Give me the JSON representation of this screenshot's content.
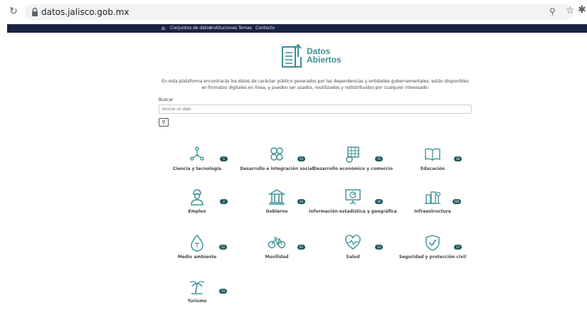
{
  "browser": {
    "url": "datos.jalisco.gob.mx"
  },
  "nav": {
    "items": [
      {
        "label": "Conjuntos de datos"
      },
      {
        "label": "Instituciones"
      },
      {
        "label": "Temas"
      },
      {
        "label": "Contacto"
      }
    ]
  },
  "logo": {
    "line1": "Datos",
    "line2": "Abiertos"
  },
  "description": "En esta plataforma encontrarás los datos de carácter público generados por las dependencias y entidades gubernamentales, están disponibles en formatos digitales en línea, y pueden ser usados, reutilizados y redistribuidos por cualquier interesado.",
  "search": {
    "label": "Buscar",
    "placeholder": "Buscar un dato"
  },
  "categories": [
    {
      "name": "Ciencia y tecnología",
      "count": "5",
      "icon": "molecule-icon"
    },
    {
      "name": "Desarrollo e integración social",
      "count": "15",
      "icon": "community-icon"
    },
    {
      "name": "Desarrollo económico y comercio",
      "count": "75",
      "icon": "commerce-icon"
    },
    {
      "name": "Educación",
      "count": "38",
      "icon": "book-icon"
    },
    {
      "name": "Empleo",
      "count": "2",
      "icon": "worker-icon"
    },
    {
      "name": "Gobierno",
      "count": "33",
      "icon": "government-building-icon"
    },
    {
      "name": "Información estadística y geográfica",
      "count": "19",
      "icon": "presentation-icon"
    },
    {
      "name": "Infraestructura",
      "count": "164",
      "icon": "city-icon"
    },
    {
      "name": "Medio ambiente",
      "count": "52",
      "icon": "drop-icon"
    },
    {
      "name": "Movilidad",
      "count": "61",
      "icon": "bicycle-icon"
    },
    {
      "name": "Salud",
      "count": "14",
      "icon": "heart-pulse-icon"
    },
    {
      "name": "Seguridad y protección civil",
      "count": "17",
      "icon": "shield-check-icon"
    },
    {
      "name": "Turismo",
      "count": "20",
      "icon": "palm-tree-icon"
    }
  ],
  "colors": {
    "nav_bg": "#1b2345",
    "accent": "#3b8f94",
    "badge": "#1f5a5e"
  }
}
